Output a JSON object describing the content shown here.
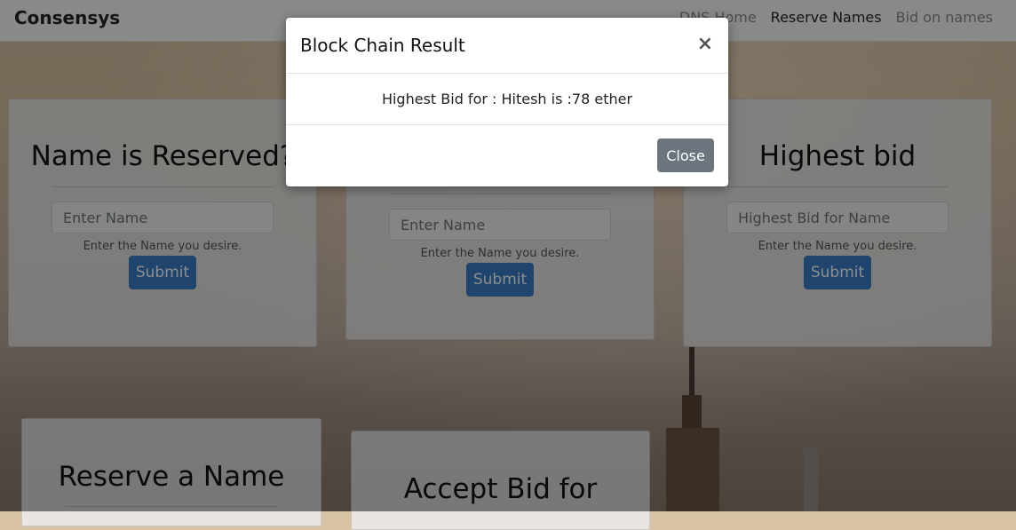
{
  "navbar": {
    "brand": "Consensys",
    "links": [
      "DNS Home",
      "Reserve Names",
      "Bid on names"
    ]
  },
  "cards": {
    "reserved": {
      "title": "Name is Reserved?",
      "placeholder": "Enter Name",
      "help": "Enter the Name you desire.",
      "submit": "Submit"
    },
    "middle": {
      "placeholder": "Enter Name",
      "help": "Enter the Name you desire.",
      "submit": "Submit"
    },
    "highest": {
      "title": "Highest bid",
      "placeholder": "Highest Bid for Name",
      "help": "Enter the Name you desire.",
      "submit": "Submit"
    },
    "reserve": {
      "title": "Reserve a Name"
    },
    "accept": {
      "title": "Accept Bid for"
    }
  },
  "modal": {
    "title": "Block Chain Result",
    "close_icon": "×",
    "body": "Highest Bid for : Hitesh is :78 ether",
    "close_button": "Close"
  }
}
